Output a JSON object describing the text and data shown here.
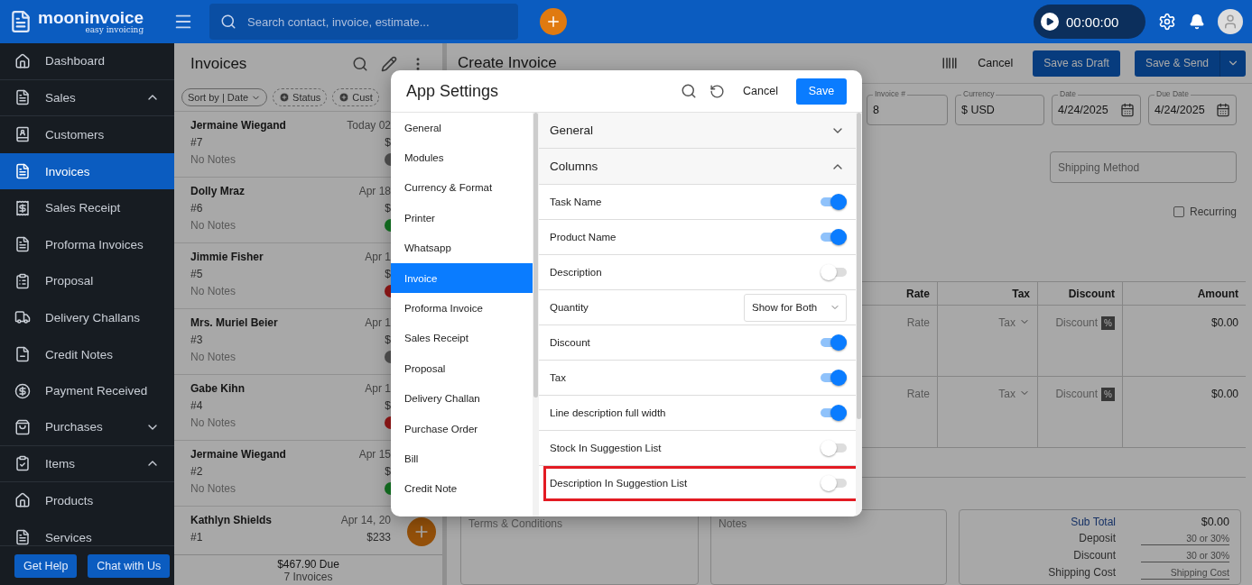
{
  "topbar": {
    "logo": "mooninvoice",
    "tagline": "easy invoicing",
    "search_placeholder": "Search contact, invoice, estimate...",
    "timer": "00:00:00"
  },
  "sidebar": {
    "items": [
      {
        "label": "Dashboard",
        "selected": false
      },
      {
        "label": "Sales",
        "selected": false,
        "expanded": true,
        "children": [
          {
            "label": "Customers",
            "selected": false
          },
          {
            "label": "Invoices",
            "selected": true
          },
          {
            "label": "Sales Receipt",
            "selected": false
          },
          {
            "label": "Proforma Invoices",
            "selected": false
          },
          {
            "label": "Proposal",
            "selected": false
          },
          {
            "label": "Delivery Challans",
            "selected": false
          },
          {
            "label": "Credit Notes",
            "selected": false
          },
          {
            "label": "Payment Received",
            "selected": false
          }
        ]
      },
      {
        "label": "Purchases",
        "selected": false,
        "expanded": false
      },
      {
        "label": "Items",
        "selected": false,
        "expanded": true,
        "children": [
          {
            "label": "Products",
            "selected": false
          },
          {
            "label": "Services",
            "selected": false
          }
        ]
      }
    ],
    "buttons": [
      "Get Help",
      "Chat with Us"
    ]
  },
  "invoice_list": {
    "title": "Invoices",
    "filters": [
      {
        "label": "Sort by | Date",
        "kind": "sort"
      },
      {
        "label": "Status",
        "kind": "add"
      },
      {
        "label": "Cust",
        "kind": "add"
      }
    ],
    "rows": [
      {
        "name": "Jermaine Wiegand",
        "date": "Today 02",
        "number": "#7",
        "amount": "$",
        "notes": "No Notes",
        "color": "#484848"
      },
      {
        "name": "Dolly Mraz",
        "date": "Apr 18",
        "number": "#6",
        "amount": "$",
        "notes": "No Notes",
        "color": "#11661e"
      },
      {
        "name": "Jimmie Fisher",
        "date": "Apr 1",
        "number": "#5",
        "amount": "$",
        "notes": "No Notes",
        "color": "#831515"
      },
      {
        "name": "Mrs. Muriel Beier",
        "date": "Apr 1",
        "number": "#3",
        "amount": "$",
        "notes": "No Notes",
        "color": "#484848"
      },
      {
        "name": "Gabe Kihn",
        "date": "Apr 1",
        "number": "#4",
        "amount": "$",
        "notes": "No Notes",
        "color": "#831515"
      },
      {
        "name": "Jermaine Wiegand",
        "date": "Apr 15",
        "number": "#2",
        "amount": "$",
        "notes": "No Notes",
        "color": "#11661e"
      },
      {
        "name": "Kathlyn Shields",
        "date": "Apr 14, 20",
        "number": "#1",
        "amount": "$233"
      }
    ],
    "summary": {
      "due": "$467.90  Due",
      "count": "7 Invoices"
    }
  },
  "invoice_form": {
    "title": "Create Invoice",
    "cancel": "Cancel",
    "draft": "Save as Draft",
    "send": "Save & Send",
    "fields": [
      {
        "label": "Invoice #",
        "value": "8",
        "kind": "text"
      },
      {
        "label": "Currency",
        "value": "$ USD",
        "kind": "text"
      },
      {
        "label": "Date",
        "value": "4/24/2025",
        "kind": "date"
      },
      {
        "label": "Due Date",
        "value": "4/24/2025",
        "kind": "date"
      }
    ],
    "shipping_placeholder": "Shipping Method",
    "recurring": {
      "label": "Recurring",
      "checked": false
    },
    "table": {
      "columns": [
        "Rate",
        "Tax",
        "Discount",
        "Amount"
      ],
      "rows": [
        {
          "rate_placeholder": "Rate",
          "tax": "Tax",
          "discount_placeholder": "Discount",
          "unit": "%",
          "amount": "$0.00"
        },
        {
          "rate_placeholder": "Rate",
          "tax": "Tax",
          "discount_placeholder": "Discount",
          "unit": "%",
          "amount": "$0.00"
        }
      ]
    },
    "terms_placeholder": "Terms & Conditions",
    "notes_placeholder": "Notes",
    "totals": [
      {
        "label": "Sub Total",
        "kind": "value",
        "value": "$0.00"
      },
      {
        "label": "Deposit",
        "kind": "input",
        "placeholder": "30 or 30%"
      },
      {
        "label": "Discount",
        "kind": "input",
        "placeholder": "30 or 30%"
      },
      {
        "label": "Shipping Cost",
        "kind": "input",
        "placeholder": "Shipping Cost"
      }
    ]
  },
  "settings_dialog": {
    "title": "App Settings",
    "cancel": "Cancel",
    "save": "Save",
    "nav": [
      {
        "label": "General",
        "selected": false
      },
      {
        "label": "Modules",
        "selected": false
      },
      {
        "label": "Currency & Format",
        "selected": false
      },
      {
        "label": "Printer",
        "selected": false
      },
      {
        "label": "Whatsapp",
        "selected": false
      },
      {
        "label": "Invoice",
        "selected": true
      },
      {
        "label": "Proforma Invoice",
        "selected": false
      },
      {
        "label": "Sales Receipt",
        "selected": false
      },
      {
        "label": "Proposal",
        "selected": false
      },
      {
        "label": "Delivery Challan",
        "selected": false
      },
      {
        "label": "Purchase Order",
        "selected": false
      },
      {
        "label": "Bill",
        "selected": false
      },
      {
        "label": "Credit Note",
        "selected": false
      }
    ],
    "sections": [
      {
        "title": "General",
        "expanded": false
      },
      {
        "title": "Columns",
        "expanded": true,
        "options": [
          {
            "label": "Task Name",
            "kind": "toggle",
            "on": true,
            "highlighted": false
          },
          {
            "label": "Product Name",
            "kind": "toggle",
            "on": true,
            "highlighted": false
          },
          {
            "label": "Description",
            "kind": "toggle",
            "on": false,
            "highlighted": false
          },
          {
            "label": "Quantity",
            "kind": "select",
            "value": "Show for Both",
            "highlighted": false
          },
          {
            "label": "Discount",
            "kind": "toggle",
            "on": true,
            "highlighted": false
          },
          {
            "label": "Tax",
            "kind": "toggle",
            "on": true,
            "highlighted": false
          },
          {
            "label": "Line description full width",
            "kind": "toggle",
            "on": true,
            "highlighted": false
          },
          {
            "label": "Stock In Suggestion List",
            "kind": "toggle",
            "on": false,
            "highlighted": false
          },
          {
            "label": "Description In Suggestion List",
            "kind": "toggle",
            "on": false,
            "highlighted": true
          }
        ]
      }
    ]
  }
}
